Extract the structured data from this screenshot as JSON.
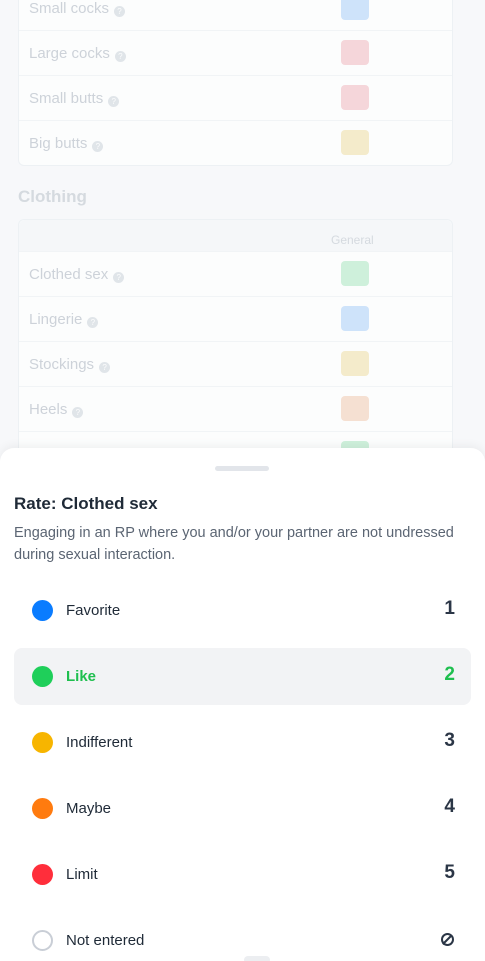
{
  "background": {
    "card_rows_1": [
      {
        "label": "Small cocks",
        "color": "#b9d8fa"
      },
      {
        "label": "Large cocks",
        "color": "#f5c4ca"
      },
      {
        "label": "Small butts",
        "color": "#f5c4ca"
      },
      {
        "label": "Big butts",
        "color": "#f3e3b3"
      }
    ],
    "section_heading": "Clothing",
    "column_header": "General",
    "card_rows_2": [
      {
        "label": "Clothed sex",
        "color": "#b8ebcb"
      },
      {
        "label": "Lingerie",
        "color": "#b9d8fa"
      },
      {
        "label": "Stockings",
        "color": "#f3e3b3"
      },
      {
        "label": "Heels",
        "color": "#f5d3bd"
      },
      {
        "label": "",
        "color": "#b8ebcb"
      }
    ]
  },
  "sheet": {
    "title": "Rate: Clothed sex",
    "description": "Engaging in an RP where you and/or your partner are not undressed during sexual interaction.",
    "options": [
      {
        "label": "Favorite",
        "value": "1",
        "color": "#0a7cff",
        "icon": "filled-circle"
      },
      {
        "label": "Like",
        "value": "2",
        "color": "#1fcf5a",
        "icon": "filled-circle",
        "selected": true
      },
      {
        "label": "Indifferent",
        "value": "3",
        "color": "#f7b500",
        "icon": "filled-circle"
      },
      {
        "label": "Maybe",
        "value": "4",
        "color": "#ff7b0f",
        "icon": "filled-circle"
      },
      {
        "label": "Limit",
        "value": "5",
        "color": "#ff2e3b",
        "icon": "filled-circle"
      },
      {
        "label": "Not entered",
        "value": "",
        "color": "#c9ced6",
        "icon": "empty-circle",
        "value_icon": "block-icon"
      }
    ]
  }
}
